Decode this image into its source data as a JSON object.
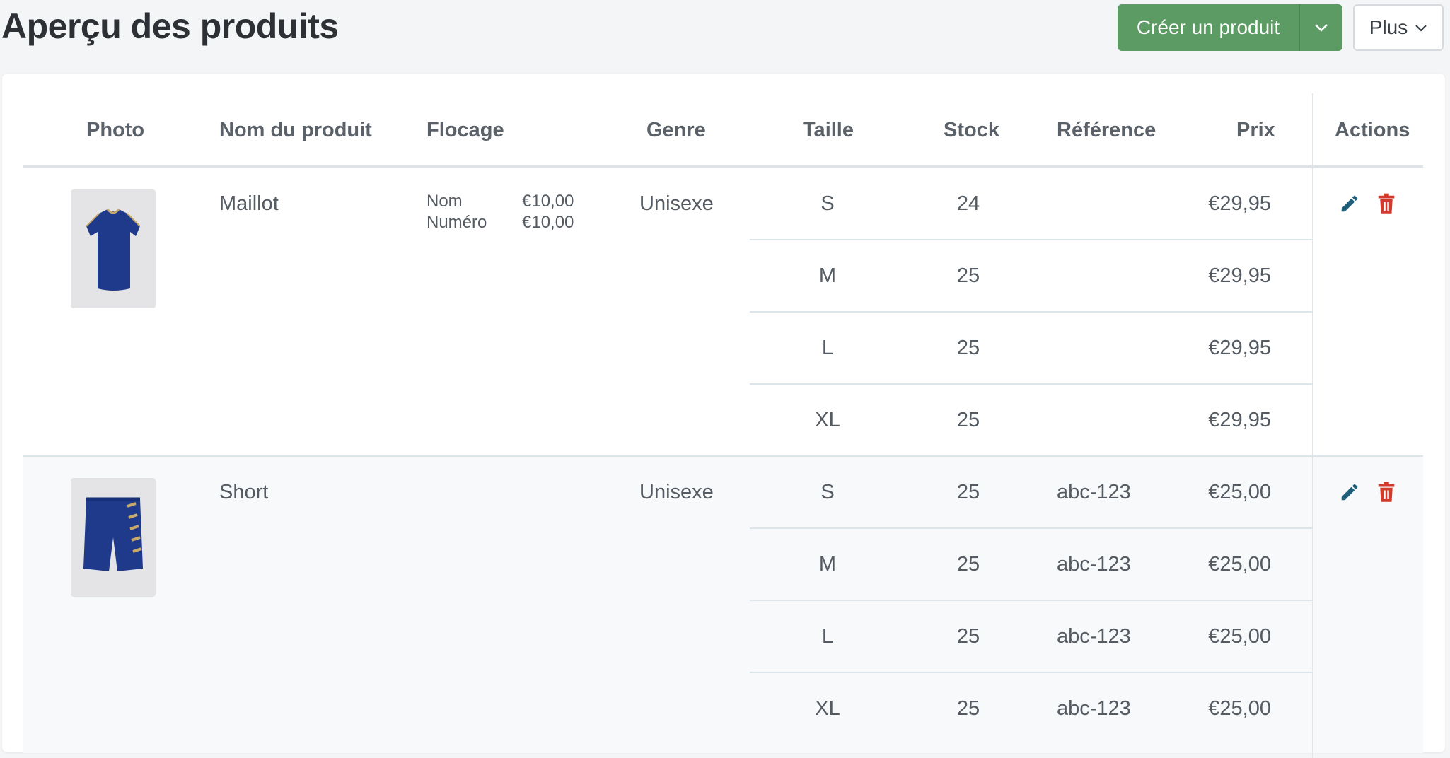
{
  "header": {
    "title": "Aperçu des produits",
    "create_label": "Créer un produit",
    "more_label": "Plus"
  },
  "table": {
    "columns": {
      "photo": "Photo",
      "name": "Nom du produit",
      "flocage": "Flocage",
      "genre": "Genre",
      "taille": "Taille",
      "stock": "Stock",
      "reference": "Référence",
      "prix": "Prix",
      "actions": "Actions"
    },
    "products": [
      {
        "name": "Maillot",
        "genre": "Unisexe",
        "image_icon": "jersey-image",
        "flocage": [
          {
            "label": "Nom",
            "price": "€10,00"
          },
          {
            "label": "Numéro",
            "price": "€10,00"
          }
        ],
        "variants": [
          {
            "size": "S",
            "stock": "24",
            "reference": "",
            "price": "€29,95"
          },
          {
            "size": "M",
            "stock": "25",
            "reference": "",
            "price": "€29,95"
          },
          {
            "size": "L",
            "stock": "25",
            "reference": "",
            "price": "€29,95"
          },
          {
            "size": "XL",
            "stock": "25",
            "reference": "",
            "price": "€29,95"
          }
        ]
      },
      {
        "name": "Short",
        "genre": "Unisexe",
        "image_icon": "shorts-image",
        "flocage": [],
        "variants": [
          {
            "size": "S",
            "stock": "25",
            "reference": "abc-123",
            "price": "€25,00"
          },
          {
            "size": "M",
            "stock": "25",
            "reference": "abc-123",
            "price": "€25,00"
          },
          {
            "size": "L",
            "stock": "25",
            "reference": "abc-123",
            "price": "€25,00"
          },
          {
            "size": "XL",
            "stock": "25",
            "reference": "abc-123",
            "price": "€25,00"
          }
        ]
      }
    ]
  },
  "colors": {
    "primary_green": "#5c9b64",
    "edit_icon": "#1f5f7a",
    "delete_icon": "#d43a2c",
    "product_blue": "#1f3a8a"
  }
}
